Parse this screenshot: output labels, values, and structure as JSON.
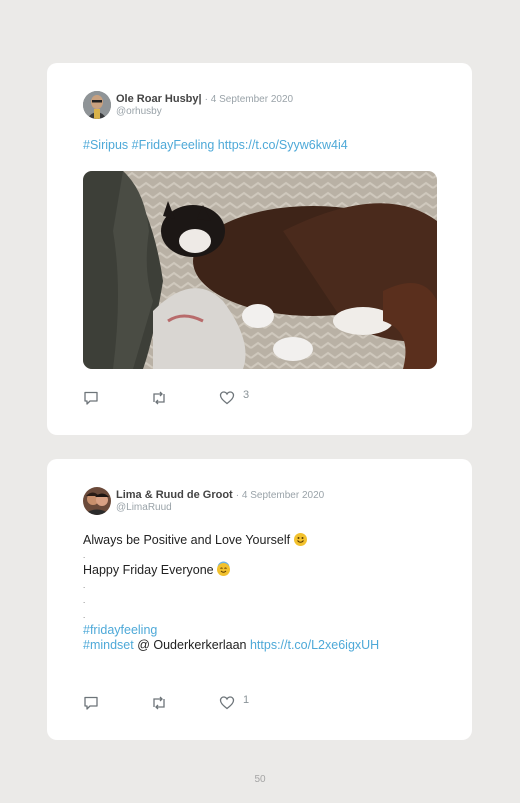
{
  "tweets": [
    {
      "author": "Ole Roar Husby",
      "author_suffix": "|",
      "date": "· 4 September 2020",
      "handle": "@orhusby",
      "hashtags": "#Siripus #FridayFeeling",
      "link": "https://t.co/Syyw6kw4i4",
      "likes": "3",
      "has_image": true
    },
    {
      "author": "Lima & Ruud de Groot",
      "date": "· 4 September 2020",
      "handle": "@LimaRuud",
      "line1": "Always be Positive and Love Yourself",
      "dot": ".",
      "line2": "Happy Friday Everyone",
      "hashtag1": "#fridayfeeling",
      "hashtag2": "#mindset",
      "location": "@ Ouderkerkerlaan",
      "link": "https://t.co/L2xe6igxUH",
      "likes": "1"
    }
  ],
  "icons": [
    "comment-icon",
    "retweet-icon",
    "heart-icon",
    "smiley-emoji",
    "halo-emoji"
  ],
  "colors": {
    "link": "#4ea9d8",
    "background": "#ebeae8",
    "card": "#ffffff"
  },
  "page_number": "50"
}
